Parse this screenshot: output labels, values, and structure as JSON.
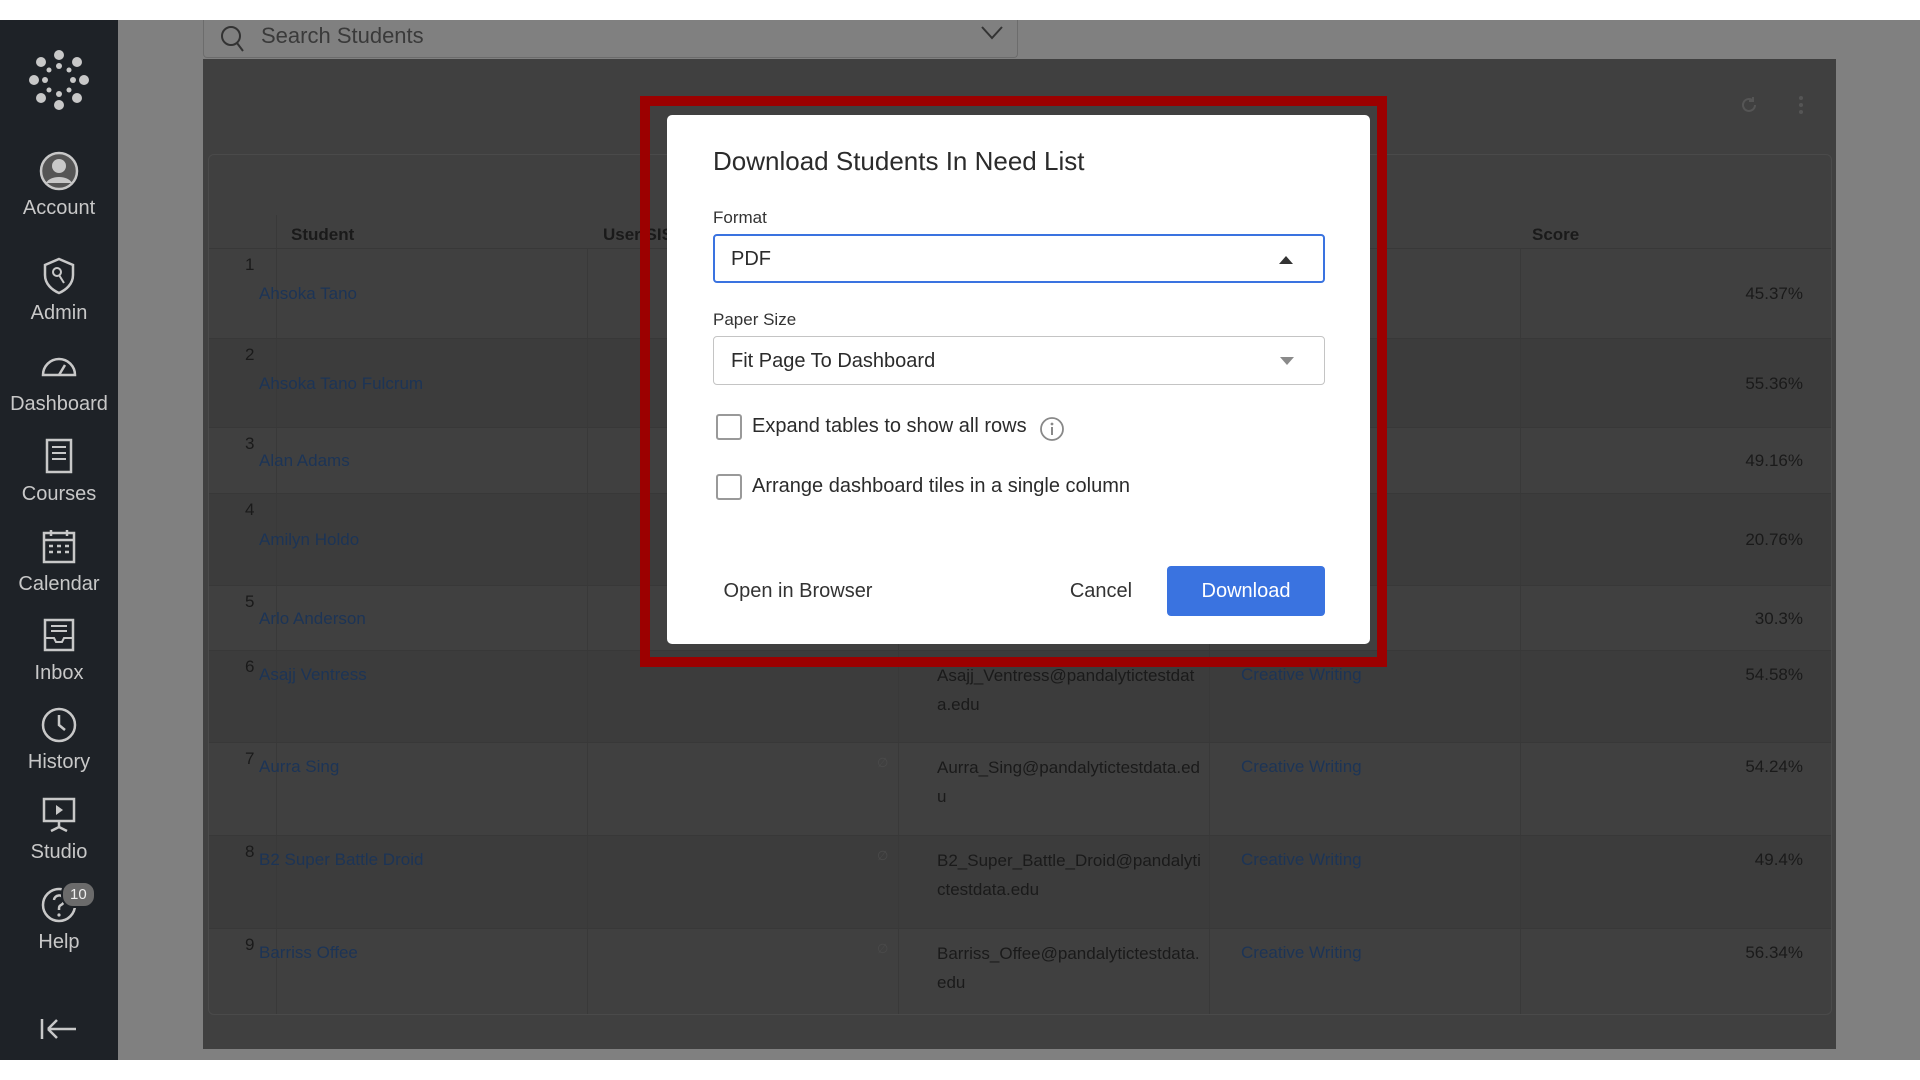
{
  "sidebar": {
    "items": [
      {
        "label": "Account",
        "icon": "account-icon"
      },
      {
        "label": "Admin",
        "icon": "admin-shield-icon"
      },
      {
        "label": "Dashboard",
        "icon": "dashboard-gauge-icon"
      },
      {
        "label": "Courses",
        "icon": "courses-book-icon"
      },
      {
        "label": "Calendar",
        "icon": "calendar-icon"
      },
      {
        "label": "Inbox",
        "icon": "inbox-icon"
      },
      {
        "label": "History",
        "icon": "history-clock-icon"
      },
      {
        "label": "Studio",
        "icon": "studio-icon"
      },
      {
        "label": "Help",
        "icon": "help-icon",
        "badge": "10"
      }
    ]
  },
  "search": {
    "placeholder": "Search Students"
  },
  "table": {
    "headers": {
      "student": "Student",
      "user_sis": "User SIS",
      "score": "Score"
    },
    "rows": [
      {
        "num": "1",
        "name": "Ahsoka Tano",
        "email": "",
        "section": "",
        "score": "45.37%"
      },
      {
        "num": "2",
        "name": "Ahsoka Tano Fulcrum",
        "email": "",
        "section": "",
        "score": "55.36%"
      },
      {
        "num": "3",
        "name": "Alan Adams",
        "email": "",
        "section": "",
        "score": "49.16%"
      },
      {
        "num": "4",
        "name": "Amilyn Holdo",
        "email": "",
        "section": "",
        "score": "20.76%"
      },
      {
        "num": "5",
        "name": "Arlo Anderson",
        "email": "",
        "section": "",
        "score": "30.3%"
      },
      {
        "num": "6",
        "name": "Asajj Ventress",
        "email": "Asajj_Ventress@pandalytictestdata.edu",
        "section": "Creative Writing",
        "score": "54.58%"
      },
      {
        "num": "7",
        "name": "Aurra Sing",
        "email": "Aurra_Sing@pandalytictestdata.edu",
        "section": "Creative Writing",
        "score": "54.24%",
        "nil": "∅"
      },
      {
        "num": "8",
        "name": "B2 Super Battle Droid",
        "email": "B2_Super_Battle_Droid@pandalytictestdata.edu",
        "section": "Creative Writing",
        "score": "49.4%",
        "nil": "∅"
      },
      {
        "num": "9",
        "name": "Barriss Offee",
        "email": "Barriss_Offee@pandalytictestdata.edu",
        "section": "Creative Writing",
        "score": "56.34%",
        "nil": "∅"
      }
    ]
  },
  "modal": {
    "title": "Download Students In Need List",
    "format_label": "Format",
    "format_value": "PDF",
    "paper_label": "Paper Size",
    "paper_value": "Fit Page To Dashboard",
    "expand_label": "Expand tables to show all rows",
    "expand_checked": false,
    "arrange_label": "Arrange dashboard tiles in a single column",
    "arrange_checked": false,
    "open_browser": "Open in Browser",
    "cancel": "Cancel",
    "download": "Download"
  },
  "colors": {
    "accent": "#3a73e0",
    "highlight": "#9c0000",
    "sidebar": "#1e2227"
  }
}
